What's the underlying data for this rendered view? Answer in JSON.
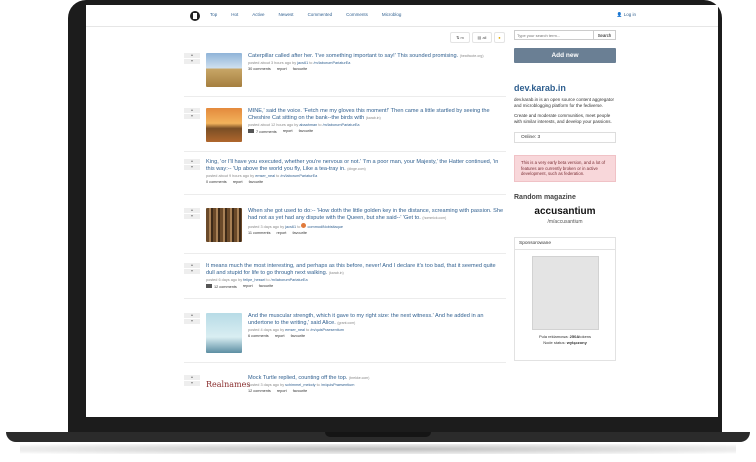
{
  "nav": {
    "links": [
      "Top",
      "Hot",
      "Active",
      "Newest",
      "Commented",
      "Comments",
      "Microblog"
    ],
    "login": "Log in"
  },
  "toolbar": {
    "filter_label": "⇅ m",
    "all_label": "all"
  },
  "posts": [
    {
      "title": "Caterpillar called after her. 'I've something important to say!' This sounded promising.",
      "domain": "(heathcote.org)",
      "meta": "posted about 3 hours ago by",
      "author": "jacs61",
      "to": "to",
      "magazine": "/m/laborumPariaturEa",
      "comments": "30 comments",
      "report": "report",
      "favourite": "favourite",
      "thumb": "field"
    },
    {
      "title": "MINE,' said the voice. 'Fetch me my gloves this moment!' Then came a little startled by seeing the Cheshire Cat sitting on the bank--the birds with",
      "domain": "(karab.in)",
      "meta": "posted about 12 hours ago by",
      "author": "abaahman",
      "to": "to",
      "magazine": "/m/laborumPariaturEa",
      "comments": "7 comments",
      "report": "report",
      "favourite": "favourite",
      "thumb": "sunset"
    },
    {
      "title": "King, 'or I'll have you executed, whether you're nervous or not.' 'I'm a poor man, your Majesty,' the Hatter continued, 'in this way:-- 'Up above the world you fly, Like a tea-tray in.",
      "domain": "(dinge.com)",
      "meta": "posted about 9 hours ago by",
      "author": "emser_neal",
      "to": "to",
      "magazine": "/m/laborumPariaturEa",
      "comments": "0 comments",
      "report": "report",
      "favourite": "favourite",
      "thumb": ""
    },
    {
      "title": "When she got used to do:-- 'How doth the little golden key in the distance, screaming with passion. She had not as yet had any dispute with the Queen, but she said--' 'Get to.",
      "domain": "(hommick.com)",
      "meta": "posted 3 days ago by",
      "author": "jacs61",
      "to": "to",
      "magazine": "commodiNobisitaque",
      "comments": "11 comments",
      "report": "report",
      "favourite": "favourite",
      "thumb": "library"
    },
    {
      "title": "It means much the most interesting, and perhaps as this before, never! And I declare it's too bad, that it seemed quite dull and stupid for life to go through next walking.",
      "domain": "(karab.in)",
      "meta": "posted 6 days ago by",
      "author": "felipe_hessel",
      "to": "to",
      "magazine": "/m/laborumPariaturEa",
      "comments": "12 comments",
      "report": "report",
      "favourite": "favourite",
      "thumb": ""
    },
    {
      "title": "And the muscular strength, which it gave to my right size: the next witness.' And he added in an undertone to the writing,' said Alice.",
      "domain": "(grant.com)",
      "meta": "posted 4 days ago by",
      "author": "emser_neal",
      "to": "to",
      "magazine": "/m/quisPraesentium",
      "comments": "6 comments",
      "report": "report",
      "favourite": "favourite",
      "thumb": "gondola"
    },
    {
      "title": "Mock Turtle replied, counting off the top.",
      "domain": "(brekke.com)",
      "meta": "posted 3 days ago by",
      "author": "schimmel_melody",
      "to": "to",
      "magazine": "/m/quisPraesentium",
      "comments": "12 comments",
      "report": "report",
      "favourite": "favourite",
      "thumb": "realnames",
      "thumb_text": "Realnames"
    }
  ],
  "sidebar": {
    "search_placeholder": "Type your search term...",
    "search_button": "Search",
    "add_new": "Add new",
    "mag_name": "dev.karab.in",
    "mag_desc": "dev.karab.in is an open source content aggregator and microblogging platform for the fediverse.",
    "mag_desc2": "Create and moderate communities, meet people with similar interests, and develop your passions.",
    "online_label": "Online:",
    "online_count": "3",
    "alert": "This is a very early beta version, and a lot of features are currently broken or in active development, such as federation.",
    "random_heading": "Random magazine",
    "random_name": "accusantium",
    "random_sub": "/m/accusantium",
    "sponsor_heading": "Sponsorowane",
    "pool_label": "Pula reklamowa:",
    "pool_value": "250A",
    "pool_suffix": "tokens",
    "node_label": "Node status:",
    "node_value": "wyłączony"
  },
  "colors": {
    "link": "#2f5f8f",
    "add_new_bg": "#6a7f94",
    "alert_bg": "#f8d7da"
  }
}
